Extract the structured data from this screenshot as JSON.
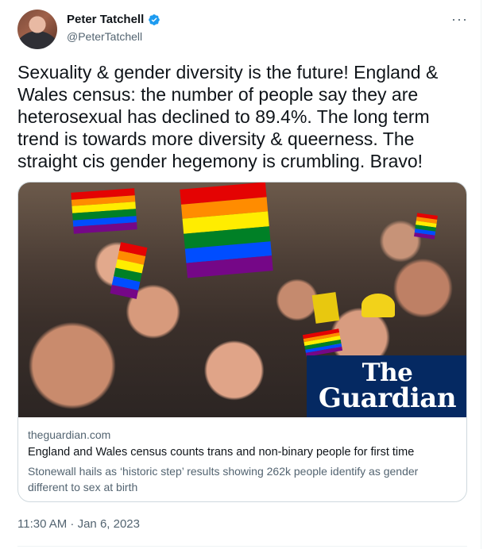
{
  "author": {
    "name": "Peter Tatchell",
    "handle": "@PeterTatchell",
    "verified_icon": "verified-badge-icon",
    "more_icon": "more-options-icon",
    "more_glyph": "···"
  },
  "tweet": {
    "text": "Sexuality & gender diversity is the future! England &\nWales census: the number of people say they are\nheterosexual has declined to 89.4%. The long term\ntrend is towards more diversity & queerness. The\nstraight cis gender hegemony is crumbling. Bravo!"
  },
  "link_card": {
    "logo_line1": "The",
    "logo_line2": "Guardian",
    "domain": "theguardian.com",
    "title": "England and Wales census counts trans and non-binary people for first time",
    "description": "Stonewall hails as ‘historic step’ results showing 262k people identify as gender different to sex at birth"
  },
  "meta": {
    "timestamp": "11:30 AM · Jan 6, 2023"
  },
  "colors": {
    "verified": "#1d9bf0",
    "guardian_blue": "#052962",
    "secondary_text": "#536471"
  }
}
